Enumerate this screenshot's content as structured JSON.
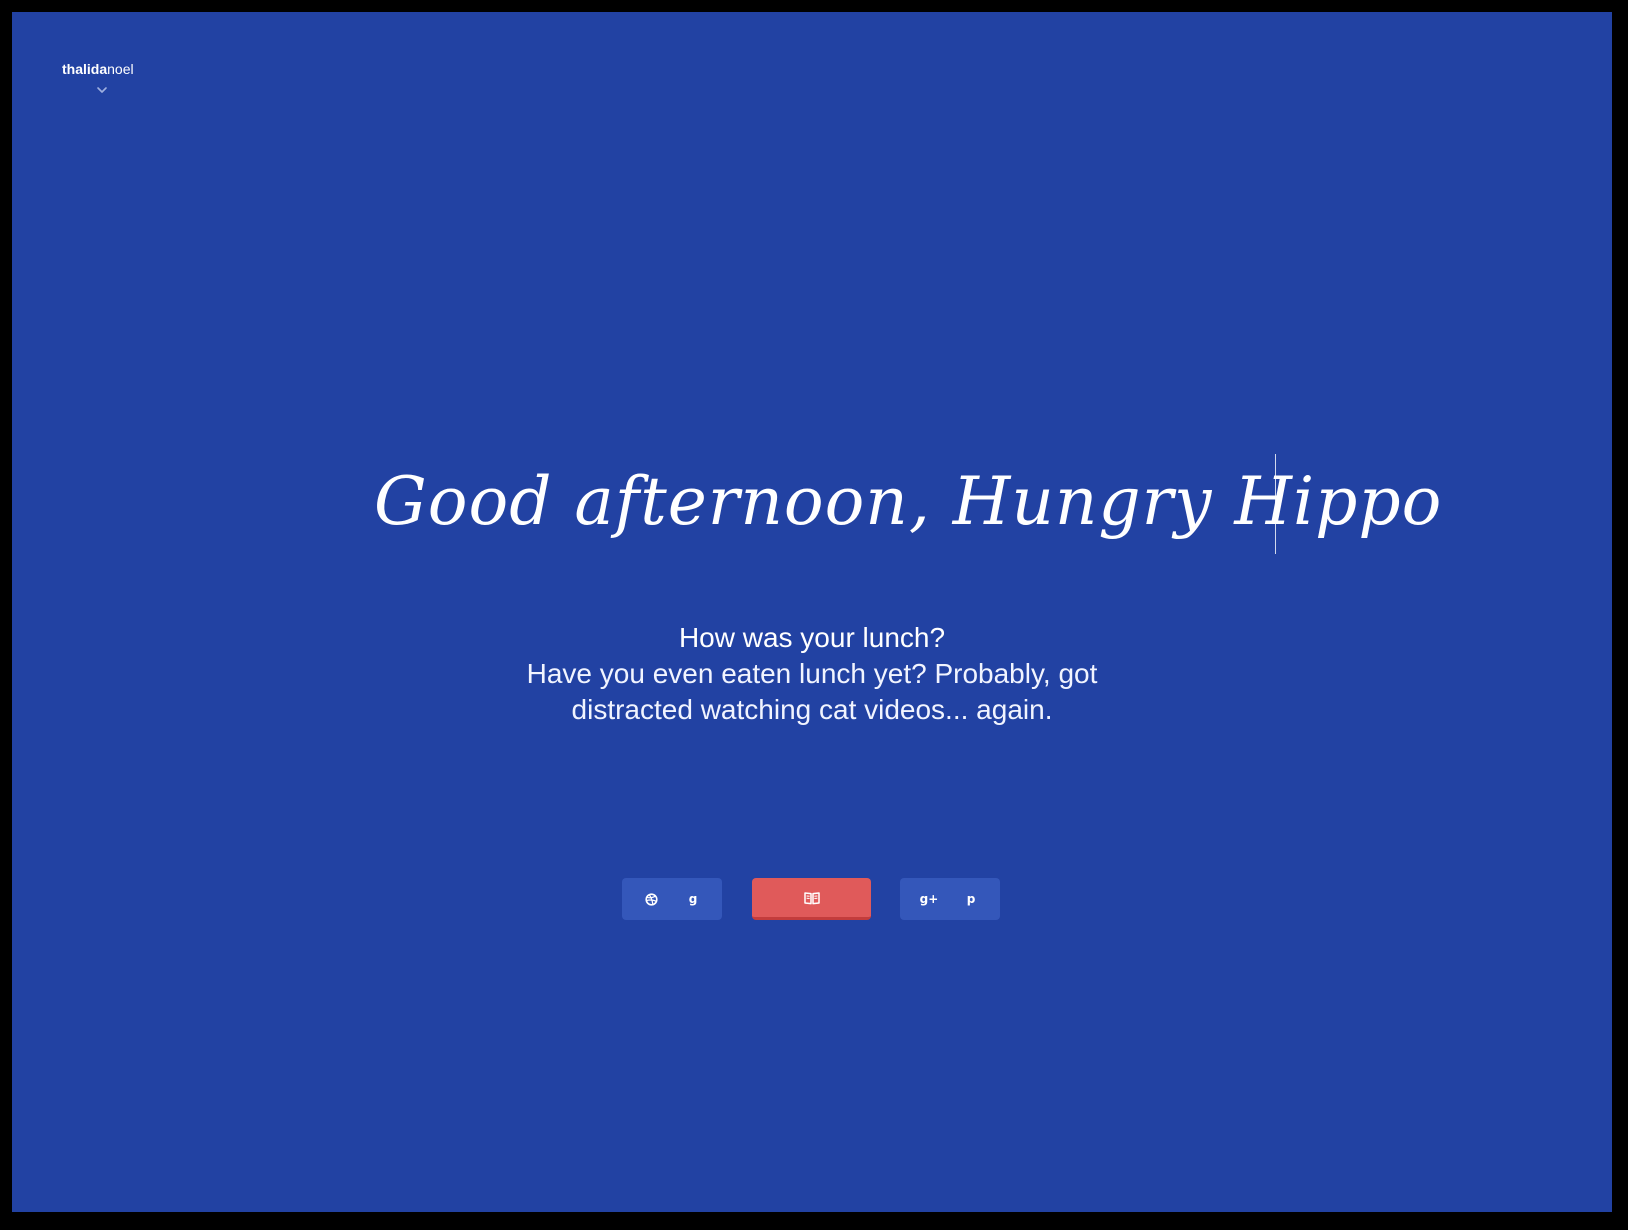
{
  "logo": {
    "bold": "thalida",
    "light": "noel",
    "menu_icon": "chevron-down-icon"
  },
  "greeting": {
    "headline": "Good afternoon, Hungry Hippo",
    "question": "How was your lunch?",
    "body": "Have you even eaten lunch yet? Probably, got distracted watching cat videos... again."
  },
  "social": {
    "left": [
      {
        "icon": "dribbble-icon"
      },
      {
        "icon": "goodreads-icon",
        "glyph": "g"
      }
    ],
    "center": {
      "icon": "book-icon"
    },
    "right": [
      {
        "icon": "google-plus-icon",
        "glyph": "g+"
      },
      {
        "icon": "pinterest-icon",
        "glyph": "p"
      }
    ]
  },
  "colors": {
    "background": "#2242a3",
    "button": "#3457ba",
    "accent": "#e05a5a",
    "accent_shadow": "#c33c3c",
    "text": "#ffffff"
  }
}
